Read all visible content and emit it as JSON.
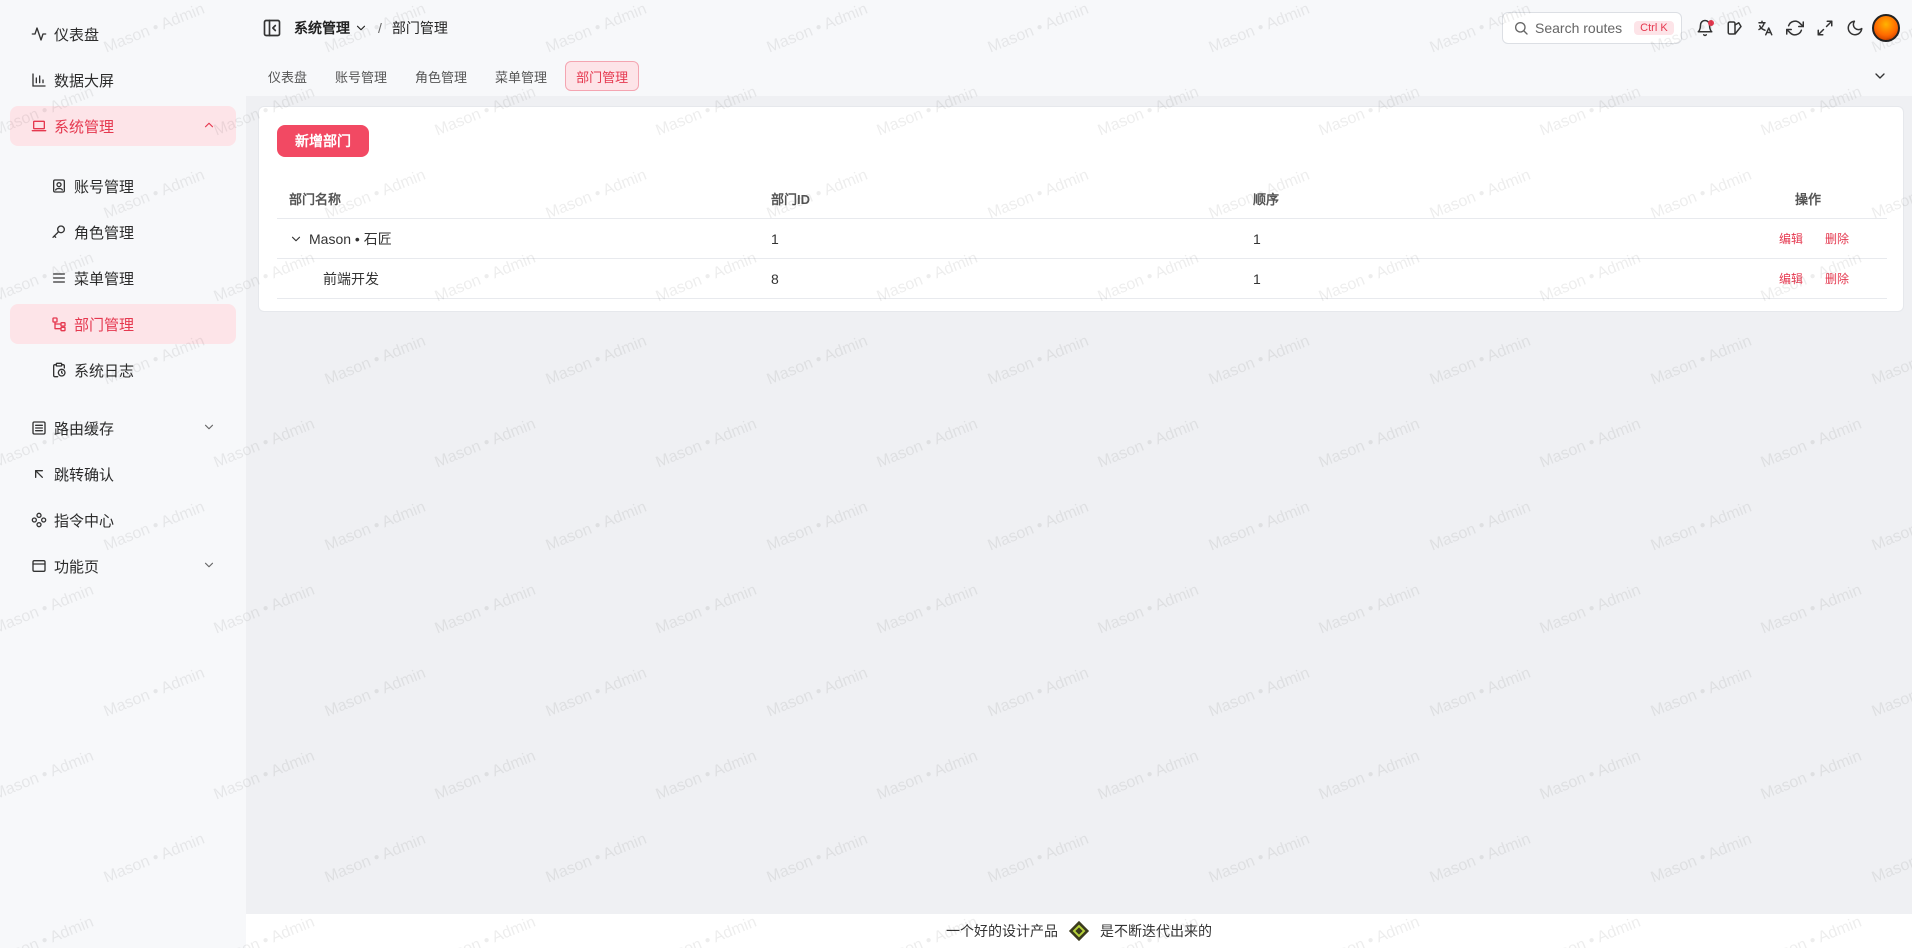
{
  "sidebar": {
    "items": [
      {
        "label": "仪表盘",
        "icon": "activity-icon"
      },
      {
        "label": "数据大屏",
        "icon": "bar-chart-icon"
      },
      {
        "label": "系统管理",
        "icon": "laptop-icon",
        "expanded": true,
        "children": [
          {
            "label": "账号管理",
            "icon": "user-card-icon"
          },
          {
            "label": "角色管理",
            "icon": "key-icon"
          },
          {
            "label": "菜单管理",
            "icon": "menu-icon"
          },
          {
            "label": "部门管理",
            "icon": "org-tree-icon",
            "active": true
          },
          {
            "label": "系统日志",
            "icon": "clock-log-icon"
          }
        ]
      },
      {
        "label": "路由缓存",
        "icon": "list-box-icon"
      },
      {
        "label": "跳转确认",
        "icon": "arrow-up-left-icon"
      },
      {
        "label": "指令中心",
        "icon": "nodes-icon"
      },
      {
        "label": "功能页",
        "icon": "browser-window-icon"
      }
    ]
  },
  "header": {
    "breadcrumb": [
      "系统管理",
      "部门管理"
    ],
    "search_placeholder": "Search routes",
    "shortcut": "Ctrl K"
  },
  "tabs": [
    "仪表盘",
    "账号管理",
    "角色管理",
    "菜单管理",
    "部门管理"
  ],
  "active_tab": "部门管理",
  "main": {
    "add_button": "新增部门",
    "columns": [
      "部门名称",
      "部门ID",
      "顺序",
      "操作"
    ],
    "rows": [
      {
        "name": "Mason • 石匠",
        "id": "1",
        "order": "1",
        "edit": "编辑",
        "delete": "删除"
      },
      {
        "name": "前端开发",
        "id": "8",
        "order": "1",
        "edit": "编辑",
        "delete": "删除"
      }
    ]
  },
  "footer": {
    "left": "一个好的设计产品",
    "right": "是不断迭代出来的"
  },
  "watermark": "Mason • Admin",
  "colors": {
    "accent": "#e5384f",
    "accent_bg": "#fde4e8",
    "primary_button": "#f24963"
  }
}
